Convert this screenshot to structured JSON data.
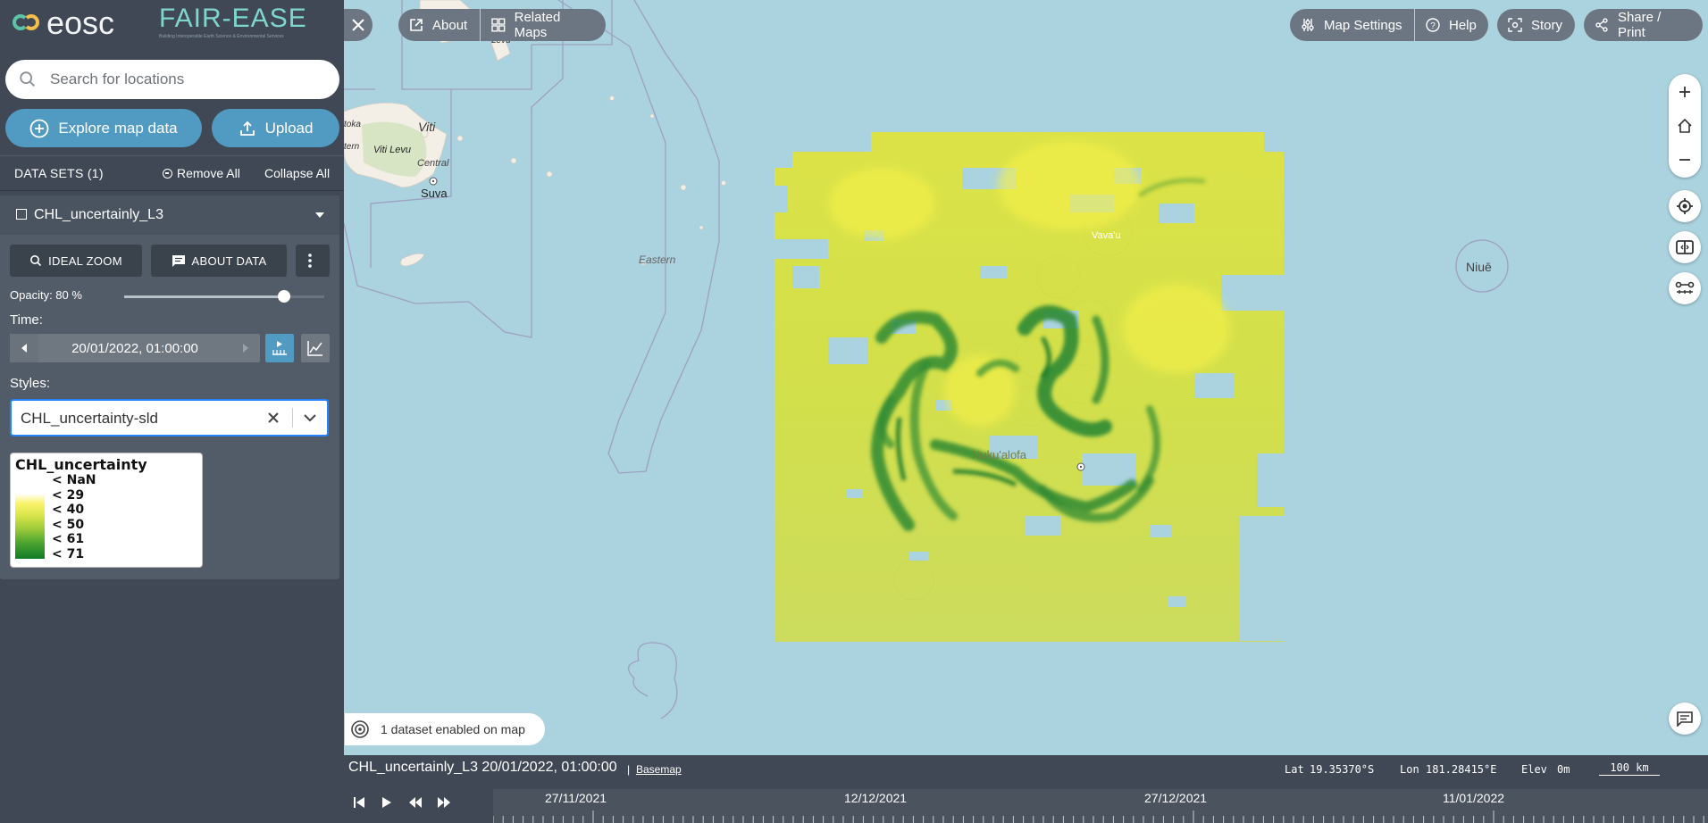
{
  "brand": {
    "eosc": "eosc",
    "fair": "FAIR-EASE",
    "fair_sub": "Building Interoperable Earth Science & Environmental Services"
  },
  "search": {
    "placeholder": "Search for locations",
    "value": ""
  },
  "buttons": {
    "explore": "Explore map data",
    "upload": "Upload"
  },
  "datasets": {
    "title": "DATA SETS (1)",
    "remove_all": "Remove All",
    "collapse_all": "Collapse All"
  },
  "dataset": {
    "name": "CHL_uncertainly_L3",
    "ideal_zoom": "IDEAL ZOOM",
    "about_data": "ABOUT DATA",
    "opacity_label": "Opacity: 80 %",
    "opacity_value": 0.8,
    "time_label": "Time:",
    "time_value": "20/01/2022, 01:00:00",
    "styles_label": "Styles:",
    "style_value": "CHL_uncertainty-sld",
    "legend": {
      "title": "CHL_uncertainty",
      "items": [
        "< NaN",
        "< 29",
        "< 40",
        "< 50",
        "< 61",
        "< 71"
      ]
    }
  },
  "map": {
    "labels": {
      "levu": "Levu",
      "viti": "Viti",
      "viti_levu": "Viti Levu",
      "toka": "toka",
      "tern": "tern",
      "central": "Central",
      "suva": "Suva",
      "eastern": "Eastern",
      "vava": "Vava'u",
      "nukualofa": "Nuku'alofa",
      "niue": "Niuē"
    },
    "status": "1 dataset enabled on map"
  },
  "toolbar": {
    "about": "About",
    "related_maps": "Related Maps",
    "map_settings": "Map Settings",
    "help": "Help",
    "story": "Story",
    "share": "Share / Print"
  },
  "info_bar": {
    "layer_caption": "CHL_uncertainly_L3 20/01/2022, 01:00:00",
    "separator": "|",
    "basemap": "Basemap",
    "lat_label": "Lat",
    "lat": "19.35370°S",
    "lon_label": "Lon",
    "lon": "181.28415°E",
    "elev_label": "Elev",
    "elev": "0m",
    "scale": "100 km"
  },
  "timeline": {
    "dates": [
      "27/11/2021",
      "12/12/2021",
      "27/12/2021",
      "11/01/2022"
    ]
  },
  "colors": {
    "accent": "#519ac2",
    "sidebar": "#3f4854",
    "ocean": "#aad3df",
    "panel": "#525c68"
  }
}
